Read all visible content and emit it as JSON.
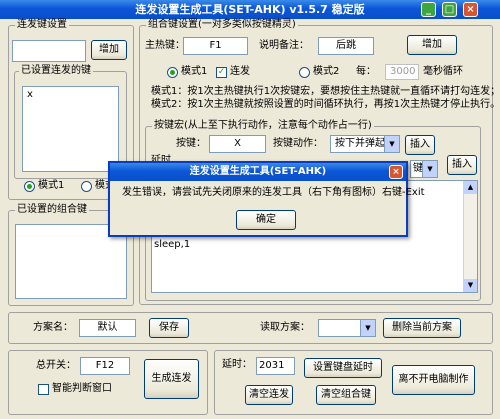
{
  "window": {
    "title": "连发设置生成工具(SET-AHK) v1.5.7 稳定版",
    "minimize_icon": "minimize-icon",
    "maximize_icon": "maximize-icon",
    "close_icon": "close-icon",
    "minimize_glyph": "_",
    "maximize_glyph": "□",
    "close_glyph": "×"
  },
  "rapid_fire": {
    "group_title": "连发键设置",
    "add_button": "增加",
    "key_value": "",
    "set_keys_title": "已设置连发的键",
    "set_keys": [
      "x"
    ],
    "mode1_label": "模式1",
    "mode2_label": "模式"
  },
  "combo_list": {
    "group_title": "已设置的组合键"
  },
  "combo_settings": {
    "group_title": "组合键设置(一对多类似按键精灵)",
    "hotkey_label": "主热键：",
    "hotkey_value": "F1",
    "remark_label": "说明备注：",
    "remark_value": "后跳",
    "add_button": "增加",
    "mode1_label": "模式1",
    "mode1_selected": true,
    "repeat_label": "连发",
    "repeat_checked": true,
    "check_glyph": "✓",
    "mode2_label": "模式2",
    "every_label": "每：",
    "interval_value": "3000",
    "interval_unit": "毫秒循环",
    "desc_line1": "模式1：按1次主热键执行1次按键宏，要想按住主热键就一直循环请打勾连发；",
    "desc_line2": "模式2：按1次主热键就按照设置的时间循环执行，再按1次主热键才停止执行。"
  },
  "macro": {
    "group_title": "按键宏(从上至下执行动作，注意每个动作占一行)",
    "key_label": "按键：",
    "key_value": "X",
    "action_label": "按键动作：",
    "action_value": "按下并弹起",
    "insert_button": "插入",
    "delay_label": "延时",
    "delay_action_value": "键",
    "insert2_button": "插入",
    "lines": [
      "sleep,1"
    ]
  },
  "scheme": {
    "name_label": "方案名：",
    "name_value": "默认",
    "save_button": "保存",
    "load_label": "读取方案：",
    "load_value": "",
    "delete_button": "删除当前方案"
  },
  "bottom": {
    "master_switch_label": "总开关：",
    "master_switch_value": "F12",
    "generate_button": "生成连发",
    "smart_window_label": "智能判断窗口",
    "delay_label": "延时：",
    "delay_value": "2031",
    "set_keyboard_delay_button": "设置键盘延时",
    "clear_rapid_button": "清空连发",
    "clear_combo_button": "清空组合键",
    "help_button": "离不开电脑制作"
  },
  "dialog": {
    "title": "连发设置生成工具(SET-AHK)",
    "message": "发生错误，请尝试先关闭原来的连发工具（右下角有图标）右键-Exit",
    "ok_button": "确定",
    "close_glyph": "×"
  },
  "icons": {
    "dropdown_glyph": "▼",
    "scroll_up_glyph": "▲",
    "scroll_down_glyph": "▼"
  },
  "colors": {
    "titlebar": "#0b56d8",
    "face": "#ece9d8",
    "close": "#d9552f",
    "min_max": "#3ea640"
  }
}
